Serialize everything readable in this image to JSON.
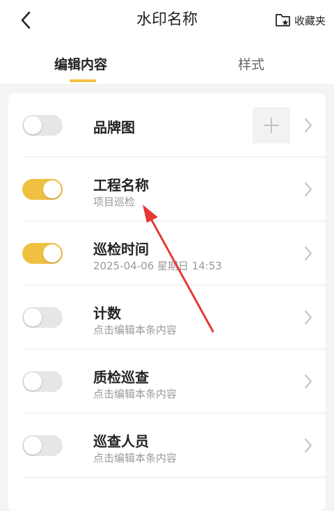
{
  "header": {
    "title": "水印名称",
    "favorite_label": "收藏夹"
  },
  "tabs": [
    {
      "label": "编辑内容",
      "active": true
    },
    {
      "label": "样式",
      "active": false
    }
  ],
  "items": [
    {
      "title": "品牌图",
      "subtitle": "",
      "enabled": false,
      "has_add": true
    },
    {
      "title": "工程名称",
      "subtitle": "项目巡检",
      "enabled": true
    },
    {
      "title": "巡检时间",
      "subtitle": "2025-04-06 星期日 14:53",
      "enabled": true
    },
    {
      "title": "计数",
      "subtitle": "点击编辑本条内容",
      "enabled": false
    },
    {
      "title": "质检巡查",
      "subtitle": "点击编辑本条内容",
      "enabled": false
    },
    {
      "title": "巡查人员",
      "subtitle": "点击编辑本条内容",
      "enabled": false
    }
  ],
  "colors": {
    "accent": "#f0c040",
    "annotation_arrow": "#e53935"
  }
}
